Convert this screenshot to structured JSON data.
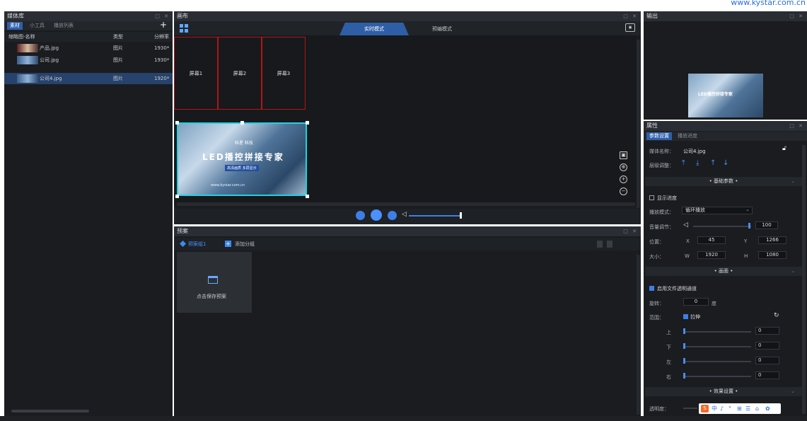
{
  "watermark": "www.kystar.com.cn",
  "library": {
    "title": "媒体库",
    "tabs": [
      "素材",
      "小工具",
      "播放列表"
    ],
    "add_symbol": "+",
    "columns": [
      "缩略图-名称",
      "类型",
      "分辨率"
    ],
    "rows": [
      {
        "name": "产品.jpg",
        "type": "图片",
        "res": "1930*"
      },
      {
        "name": "公司.jpg",
        "type": "图片",
        "res": "1930*"
      },
      {
        "name": "公司4.jpg",
        "type": "图片",
        "res": "1920*"
      }
    ]
  },
  "layout": {
    "title": "画布",
    "mode_live": "实时模式",
    "mode_preview": "预编模式",
    "screens": [
      "屏幕1",
      "屏幕2",
      "屏幕3"
    ],
    "banner_brand": "科星 科技",
    "banner_title": "LED播控拼接专家",
    "banner_sub": "高清画质  多屏显示",
    "banner_url": "www.kystar.com.cn"
  },
  "preset": {
    "title": "预案",
    "tab_group": "预案组1",
    "add_group": "添加分组",
    "save_label": "点击保存预案"
  },
  "output": {
    "title": "输出",
    "thumb_title": "LED播控拼接专家"
  },
  "props": {
    "title": "属性",
    "tab_params": "参数设置",
    "tab_progress": "播放进度",
    "media_name_label": "媒体名称：",
    "media_name": "公司4.jpg",
    "layer_label": "层级调整：",
    "sec_basic": "• 基础参数 •",
    "chk_progress": "显示进度",
    "play_mode_label": "播放模式：",
    "play_mode": "循环播放",
    "volume_label": "音量调节：",
    "volume": "100",
    "pos_label": "位置：",
    "x_label": "X",
    "x": "45",
    "y_label": "Y",
    "y": "1266",
    "size_label": "大小：",
    "w_label": "W",
    "w": "1920",
    "h_label": "H",
    "h": "1080",
    "sec_picture": "• 画面 •",
    "chk_alpha": "启用文件透明通道",
    "rotate_label": "旋转：",
    "rotate": "0",
    "rotate_unit": "度",
    "range_label": "范围：",
    "stretch": "拉伸",
    "top": "上",
    "bottom": "下",
    "left": "左",
    "right": "右",
    "crop_val": "0",
    "sec_effect": "• 效果设置 •",
    "opacity_label": "透明度："
  },
  "ime": {
    "items": [
      "中",
      "♪",
      "°",
      "⊞",
      "☰",
      "⌂",
      "✿"
    ]
  }
}
